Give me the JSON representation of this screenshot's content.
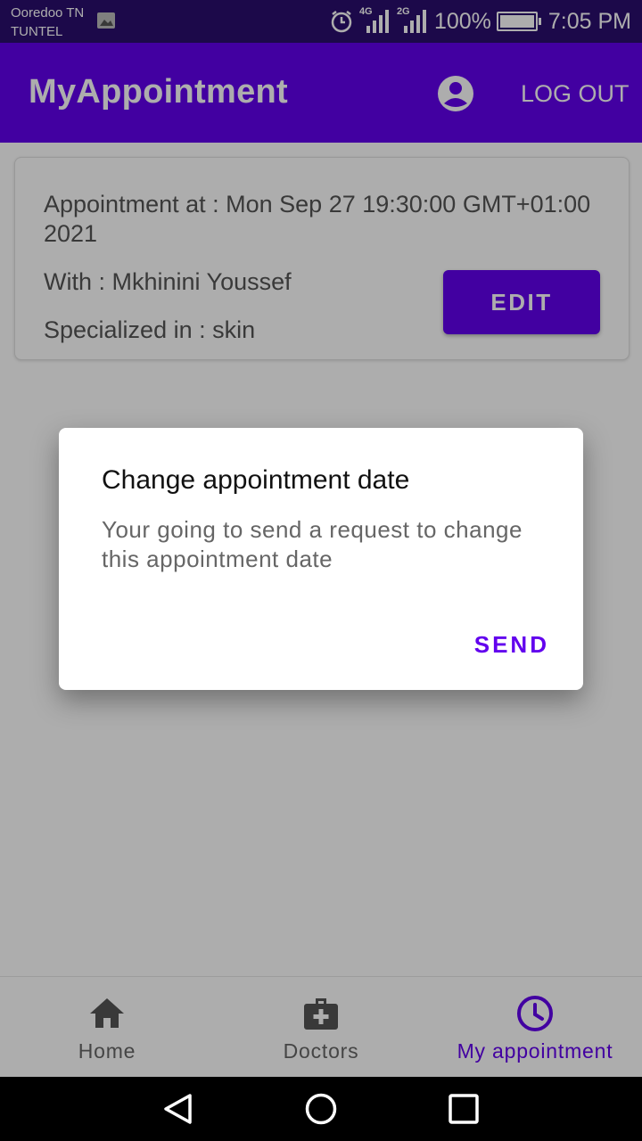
{
  "status_bar": {
    "carrier_line1": "Ooredoo TN",
    "carrier_line2": "TUNTEL",
    "net1": "4G",
    "net2": "2G",
    "battery": "100%",
    "time": "7:05 PM"
  },
  "app_bar": {
    "title": "MyAppointment",
    "logout_label": "LOG OUT"
  },
  "appointment_card": {
    "datetime_text": "Appointment at : Mon Sep 27 19:30:00 GMT+01:00 2021",
    "doctor_text": "With : Mkhinini Youssef",
    "specialty_text": "Specialized in : skin",
    "edit_label": "EDIT"
  },
  "dialog": {
    "title": "Change appointment date",
    "message": "Your going to send a request to change this appointment date",
    "send_label": "SEND"
  },
  "bottom_nav": {
    "items": [
      {
        "label": "Home",
        "icon": "home-icon"
      },
      {
        "label": "Doctors",
        "icon": "medical-bag-icon"
      },
      {
        "label": "My appointment",
        "icon": "clock-icon",
        "active": true
      }
    ]
  },
  "colors": {
    "primary": "#6200ee",
    "status_bar": "#2a0e6e",
    "nav_inactive": "#666666"
  }
}
